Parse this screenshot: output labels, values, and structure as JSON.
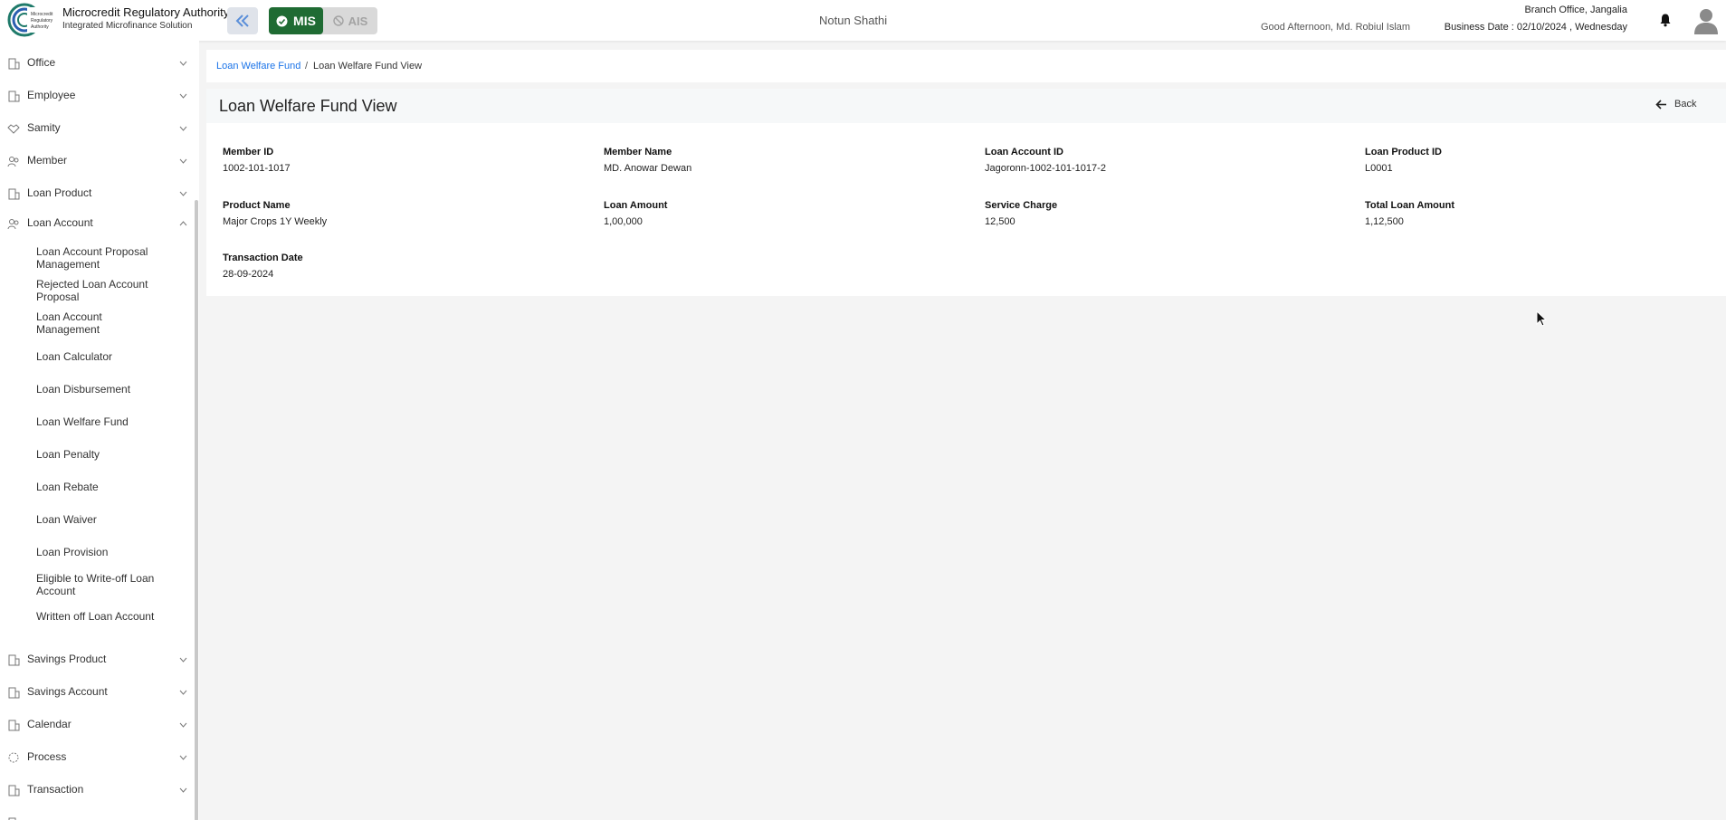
{
  "header": {
    "org_title": "Microcredit Regulatory Authority",
    "org_subtitle": "Integrated Microfinance Solution",
    "logo_text": "Microcredit Regulatory Authority",
    "mode_mis": "MIS",
    "mode_ais": "AIS",
    "app_name": "Notun Shathi",
    "greeting": "Good Afternoon, Md. Robiul Islam",
    "branch": "Branch Office, Jangalia",
    "business_date": "Business Date : 02/10/2024 , Wednesday",
    "active_color": "#1f6b33"
  },
  "sidebar": {
    "items": [
      {
        "label": "Office",
        "icon": "building-icon"
      },
      {
        "label": "Employee",
        "icon": "building-icon"
      },
      {
        "label": "Samity",
        "icon": "handshake-icon"
      },
      {
        "label": "Member",
        "icon": "group-icon"
      },
      {
        "label": "Loan Product",
        "icon": "building-icon"
      },
      {
        "label": "Loan Account",
        "icon": "group-icon"
      },
      {
        "label": "Savings Product",
        "icon": "building-icon"
      },
      {
        "label": "Savings Account",
        "icon": "building-icon"
      },
      {
        "label": "Calendar",
        "icon": "building-icon"
      },
      {
        "label": "Process",
        "icon": "loading-icon"
      },
      {
        "label": "Transaction",
        "icon": "building-icon"
      }
    ],
    "sub_items": [
      "Loan Account Proposal Management",
      "Rejected Loan Account Proposal",
      "Loan Account Management",
      "Loan Calculator",
      "Loan Disbursement",
      "Loan Welfare Fund",
      "Loan Penalty",
      "Loan Rebate",
      "Loan Waiver",
      "Loan Provision",
      "Eligible to Write-off Loan Account",
      "Written off Loan Account"
    ]
  },
  "breadcrumb": {
    "parent": "Loan Welfare Fund",
    "separator": "/",
    "current": "Loan Welfare Fund View"
  },
  "card": {
    "title": "Loan Welfare Fund View",
    "back_label": "Back",
    "fields": [
      {
        "label": "Member ID",
        "value": "1002-101-1017"
      },
      {
        "label": "Member Name",
        "value": "MD. Anowar Dewan"
      },
      {
        "label": "Loan Account ID",
        "value": "Jagoronn-1002-101-1017-2"
      },
      {
        "label": "Loan Product ID",
        "value": "L0001"
      },
      {
        "label": "Product Name",
        "value": "Major Crops 1Y Weekly"
      },
      {
        "label": "Loan Amount",
        "value": "1,00,000"
      },
      {
        "label": "Service Charge",
        "value": "12,500"
      },
      {
        "label": "Total Loan Amount",
        "value": "1,12,500"
      },
      {
        "label": "Transaction Date",
        "value": "28-09-2024"
      }
    ]
  }
}
